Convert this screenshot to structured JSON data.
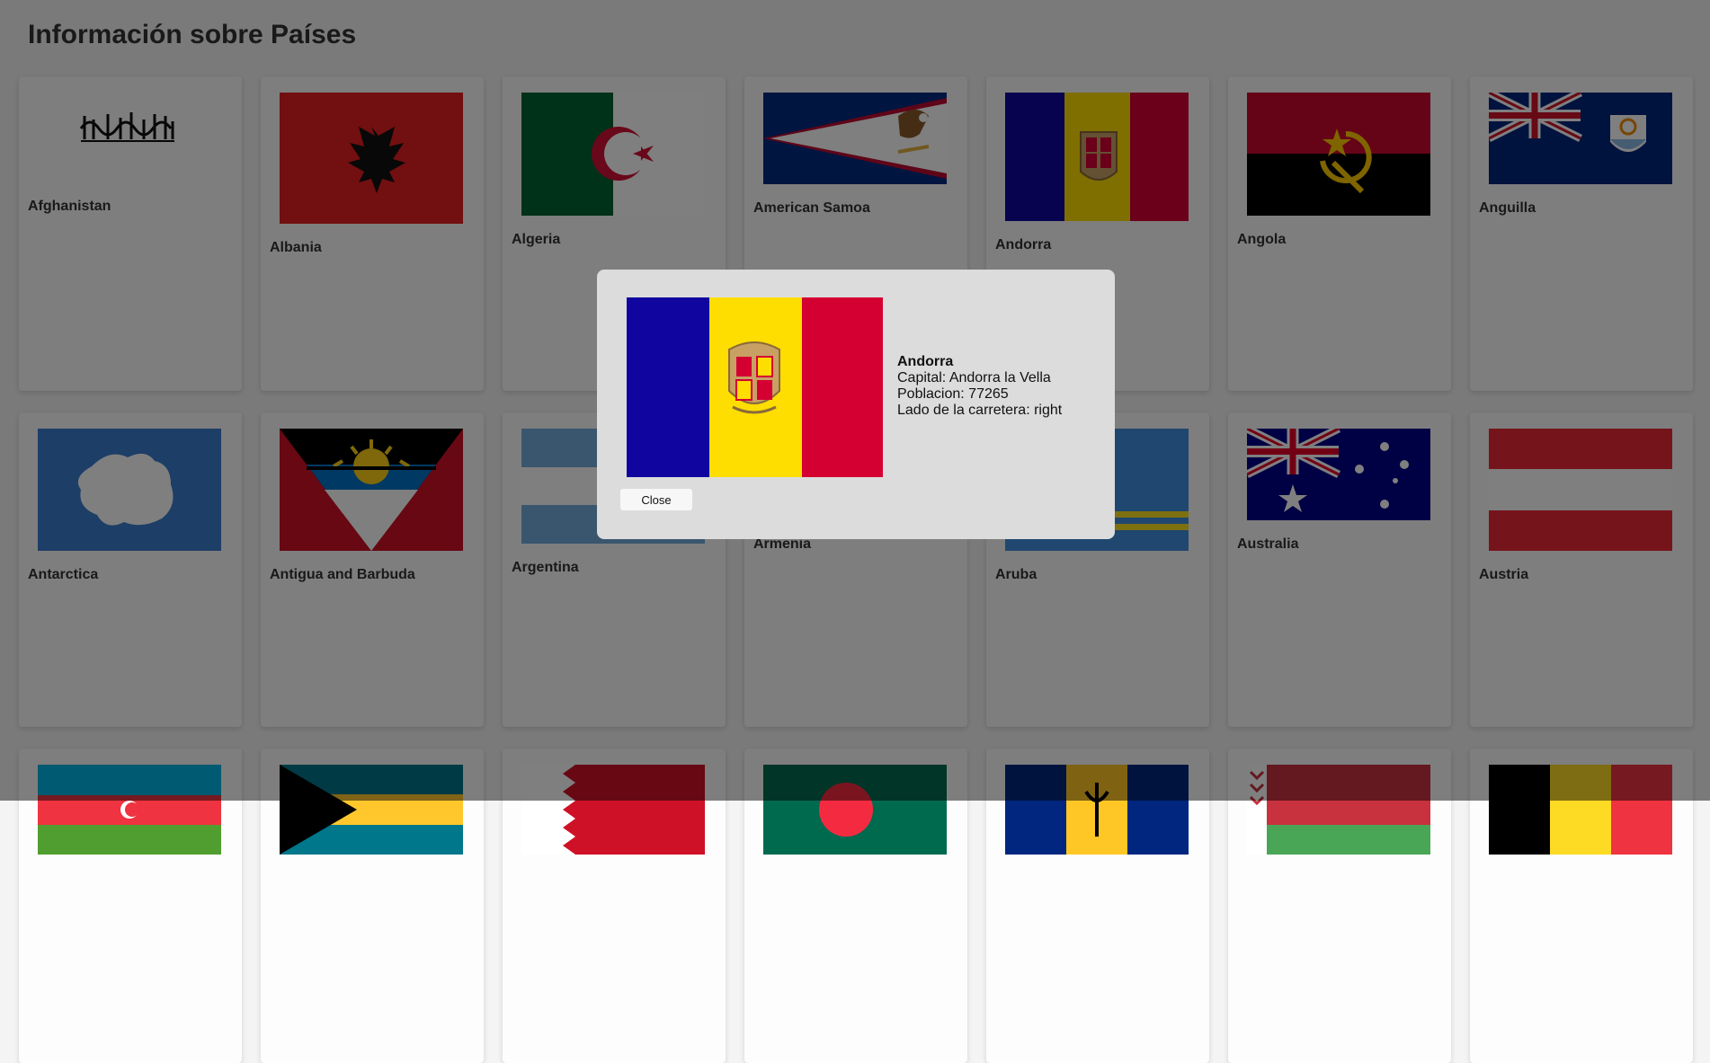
{
  "page": {
    "title": "Información sobre Países"
  },
  "countries": [
    {
      "name": "Afghanistan",
      "flag": "afghanistan-flag",
      "flag_h": 100
    },
    {
      "name": "Albania",
      "flag": "albania-flag",
      "flag_h": 146
    },
    {
      "name": "Algeria",
      "flag": "algeria-flag",
      "flag_h": 137
    },
    {
      "name": "American Samoa",
      "flag": "american-samoa-flag",
      "flag_h": 102
    },
    {
      "name": "Andorra",
      "flag": "andorra-flag",
      "flag_h": 143
    },
    {
      "name": "Angola",
      "flag": "angola-flag",
      "flag_h": 137
    },
    {
      "name": "Anguilla",
      "flag": "anguilla-flag",
      "flag_h": 102
    },
    {
      "name": "Antarctica",
      "flag": "antarctica-flag",
      "flag_h": 136
    },
    {
      "name": "Antigua and Barbuda",
      "flag": "antigua-flag",
      "flag_h": 136
    },
    {
      "name": "Argentina",
      "flag": "argentina-flag",
      "flag_h": 128
    },
    {
      "name": "Armenia",
      "flag": "armenia-flag",
      "flag_h": 102
    },
    {
      "name": "Aruba",
      "flag": "aruba-flag",
      "flag_h": 136
    },
    {
      "name": "Australia",
      "flag": "australia-flag",
      "flag_h": 102
    },
    {
      "name": "Austria",
      "flag": "austria-flag",
      "flag_h": 136
    },
    {
      "name": "",
      "flag": "azerbaijan-flag",
      "flag_h": 100
    },
    {
      "name": "",
      "flag": "bahamas-flag",
      "flag_h": 100
    },
    {
      "name": "",
      "flag": "bahrain-flag",
      "flag_h": 100
    },
    {
      "name": "",
      "flag": "bangladesh-flag",
      "flag_h": 100
    },
    {
      "name": "",
      "flag": "barbados-flag",
      "flag_h": 100
    },
    {
      "name": "",
      "flag": "belarus-flag",
      "flag_h": 100
    },
    {
      "name": "",
      "flag": "belgium-flag",
      "flag_h": 100
    }
  ],
  "modal": {
    "country": "Andorra",
    "capital": "Capital: Andorra la Vella",
    "population": "Poblacion: 77265",
    "driving_side": "Lado de la carretera: right",
    "close_label": "Close"
  }
}
